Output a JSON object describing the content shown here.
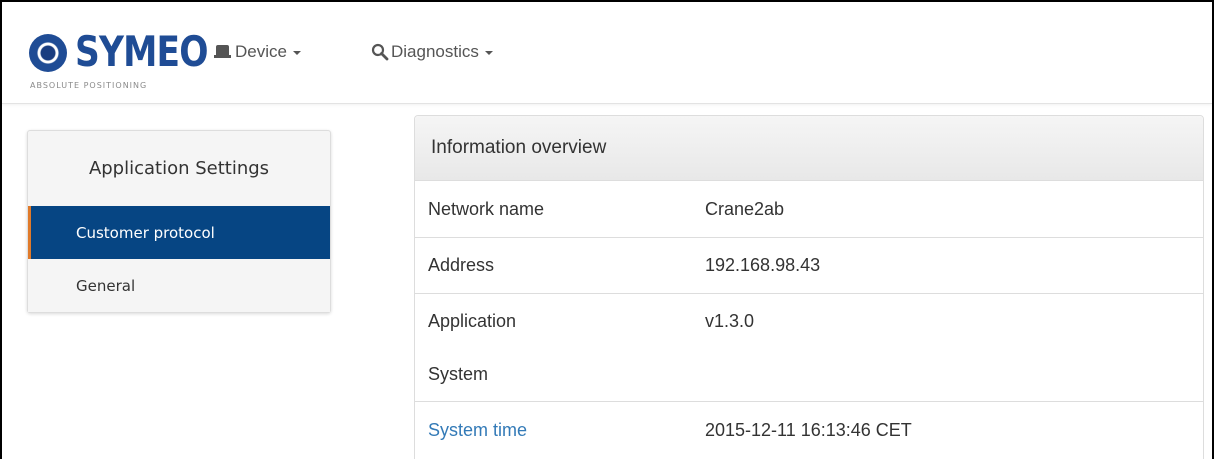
{
  "logo": {
    "brand": "SYMEO",
    "tagline": "ABSOLUTE POSITIONING"
  },
  "navbar": {
    "items": [
      {
        "label": "Device",
        "icon": "device-icon"
      },
      {
        "label": "Diagnostics",
        "icon": "search-icon"
      }
    ]
  },
  "sidebar": {
    "title": "Application Settings",
    "items": [
      {
        "label": "Customer protocol",
        "active": true
      },
      {
        "label": "General",
        "active": false
      }
    ]
  },
  "panel": {
    "title": "Information overview",
    "rows": [
      {
        "key": "Network name",
        "value": "Crane2ab"
      },
      {
        "key": "Address",
        "value": "192.168.98.43"
      },
      {
        "key": "Application",
        "value": "v1.3.0"
      },
      {
        "key": "System",
        "value": ""
      },
      {
        "key": "System time",
        "value": "2015-12-11 16:13:46 CET"
      }
    ]
  },
  "colors": {
    "brand": "#1f4c95",
    "active_bg": "#064583",
    "active_accent": "#e07a2a",
    "link": "#337ab7"
  }
}
